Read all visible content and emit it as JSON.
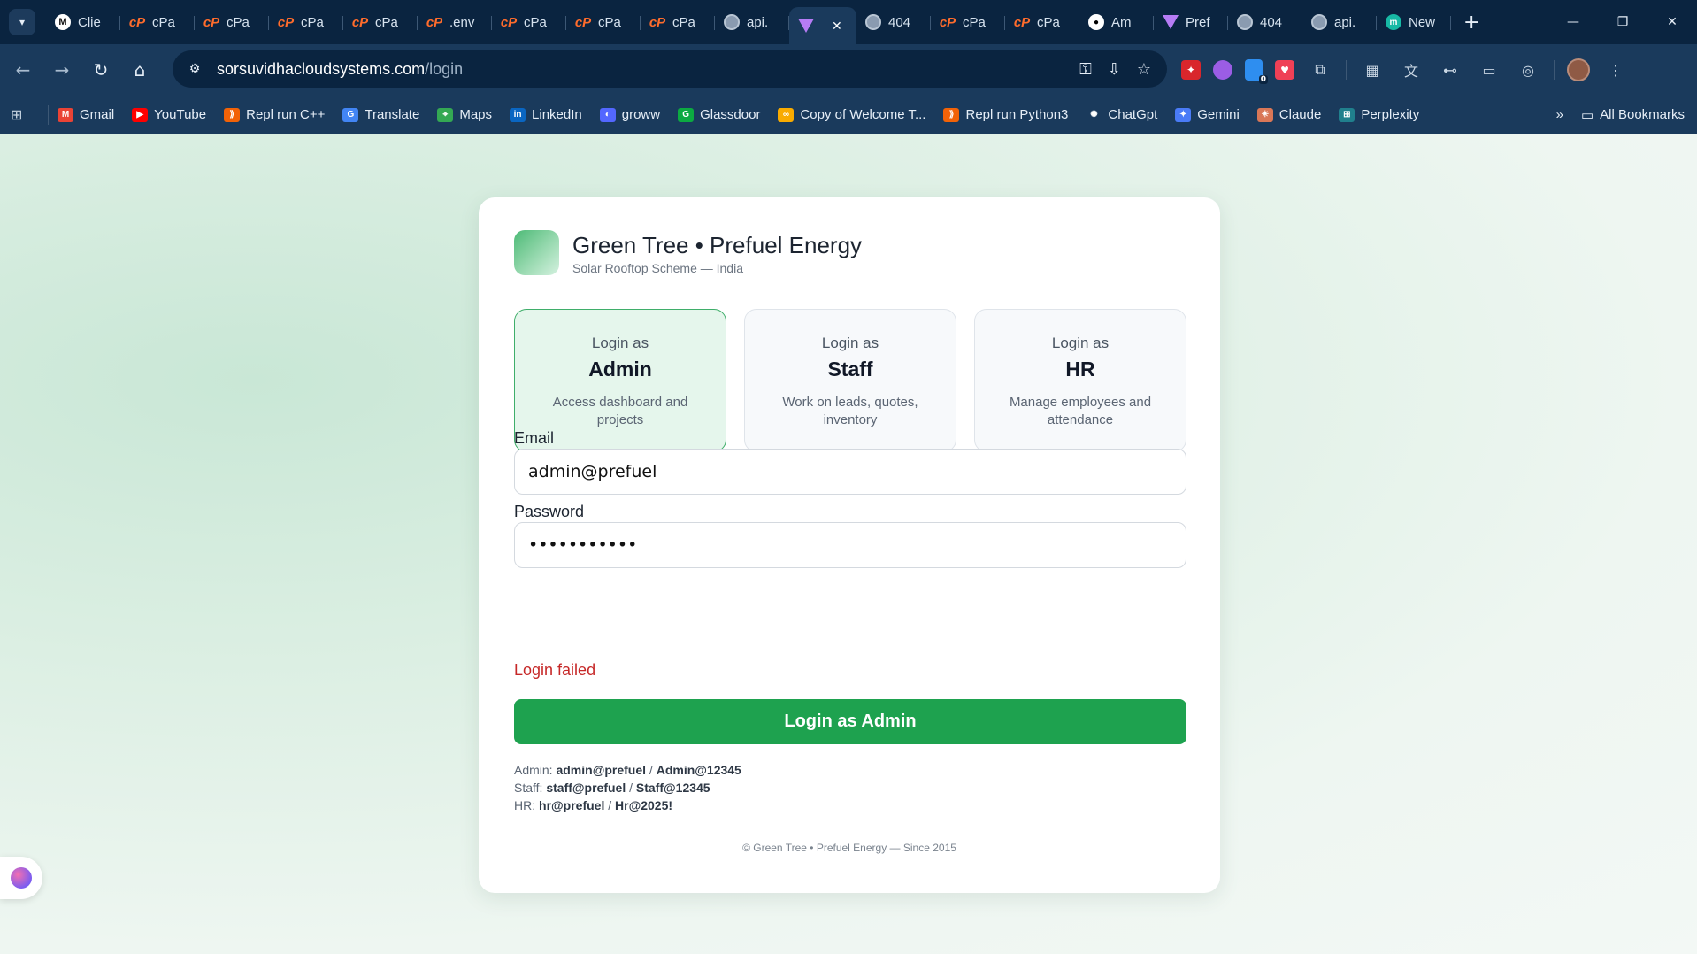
{
  "browser": {
    "tabs": [
      {
        "label": "Clie",
        "icon": "m-icon"
      },
      {
        "label": "cPa",
        "icon": "cpanel-icon"
      },
      {
        "label": "cPa",
        "icon": "cpanel-icon"
      },
      {
        "label": "cPa",
        "icon": "cpanel-icon"
      },
      {
        "label": "cPa",
        "icon": "cpanel-icon"
      },
      {
        "label": ".env",
        "icon": "cpanel-icon"
      },
      {
        "label": "cPa",
        "icon": "cpanel-icon"
      },
      {
        "label": "cPa",
        "icon": "cpanel-icon"
      },
      {
        "label": "cPa",
        "icon": "cpanel-icon"
      },
      {
        "label": "api.",
        "icon": "globe-icon"
      },
      {
        "label": "",
        "icon": "vite-icon",
        "active": true
      },
      {
        "label": "404",
        "icon": "globe-icon"
      },
      {
        "label": "cPa",
        "icon": "cpanel-icon"
      },
      {
        "label": "cPa",
        "icon": "cpanel-icon"
      },
      {
        "label": "Am",
        "icon": "github-icon"
      },
      {
        "label": "Pref",
        "icon": "vite-icon"
      },
      {
        "label": "404",
        "icon": "globe-icon"
      },
      {
        "label": "api.",
        "icon": "globe-icon"
      },
      {
        "label": "New",
        "icon": "m-teal-icon"
      }
    ],
    "url_host": "sorsuvidhacloudsystems.com",
    "url_path": "/login",
    "bookmarks": [
      {
        "label": "Gmail",
        "color": "#ea4335",
        "glyph": "M"
      },
      {
        "label": "YouTube",
        "color": "#ff0000",
        "glyph": "▶"
      },
      {
        "label": "Repl run C++",
        "color": "#f26207",
        "glyph": "⟫"
      },
      {
        "label": "Translate",
        "color": "#4285f4",
        "glyph": "G"
      },
      {
        "label": "Maps",
        "color": "#34a853",
        "glyph": "⌖"
      },
      {
        "label": "LinkedIn",
        "color": "#0a66c2",
        "glyph": "in"
      },
      {
        "label": "groww",
        "color": "#5367ff",
        "glyph": "◐"
      },
      {
        "label": "Glassdoor",
        "color": "#0caa41",
        "glyph": "G"
      },
      {
        "label": "Copy of Welcome T...",
        "color": "#f9ab00",
        "glyph": "∞"
      },
      {
        "label": "Repl run Python3",
        "color": "#f26207",
        "glyph": "⟫"
      },
      {
        "label": "ChatGpt",
        "color": "#1a3a5c",
        "glyph": "✺"
      },
      {
        "label": "Gemini",
        "color": "#4a7bf7",
        "glyph": "✦"
      },
      {
        "label": "Claude",
        "color": "#d97757",
        "glyph": "✳"
      },
      {
        "label": "Perplexity",
        "color": "#20808d",
        "glyph": "⊞"
      }
    ],
    "all_bookmarks": "All Bookmarks"
  },
  "app": {
    "brand_title": "Green Tree • Prefuel Energy",
    "brand_subtitle": "Solar Rooftop Scheme — India",
    "roles": [
      {
        "pre": "Login as",
        "name": "Admin",
        "desc": "Access dashboard and projects",
        "selected": true
      },
      {
        "pre": "Login as",
        "name": "Staff",
        "desc": "Work on leads, quotes, inventory",
        "selected": false
      },
      {
        "pre": "Login as",
        "name": "HR",
        "desc": "Manage employees and attendance",
        "selected": false
      }
    ],
    "email_label": "Email",
    "email_value": "admin@prefuel",
    "password_label": "Password",
    "password_value": "Admin@12345",
    "error": "Login failed",
    "submit_label": "Login as Admin",
    "creds": [
      {
        "role": "Admin:",
        "user": "admin@prefuel",
        "sep": "/",
        "pass": "Admin@12345"
      },
      {
        "role": "Staff:",
        "user": "staff@prefuel",
        "sep": "/",
        "pass": "Staff@12345"
      },
      {
        "role": "HR:",
        "user": "hr@prefuel",
        "sep": "/",
        "pass": "Hr@2025!"
      }
    ],
    "footer": "© Green Tree • Prefuel Energy — Since 2015",
    "accent": "#1ea24f"
  }
}
